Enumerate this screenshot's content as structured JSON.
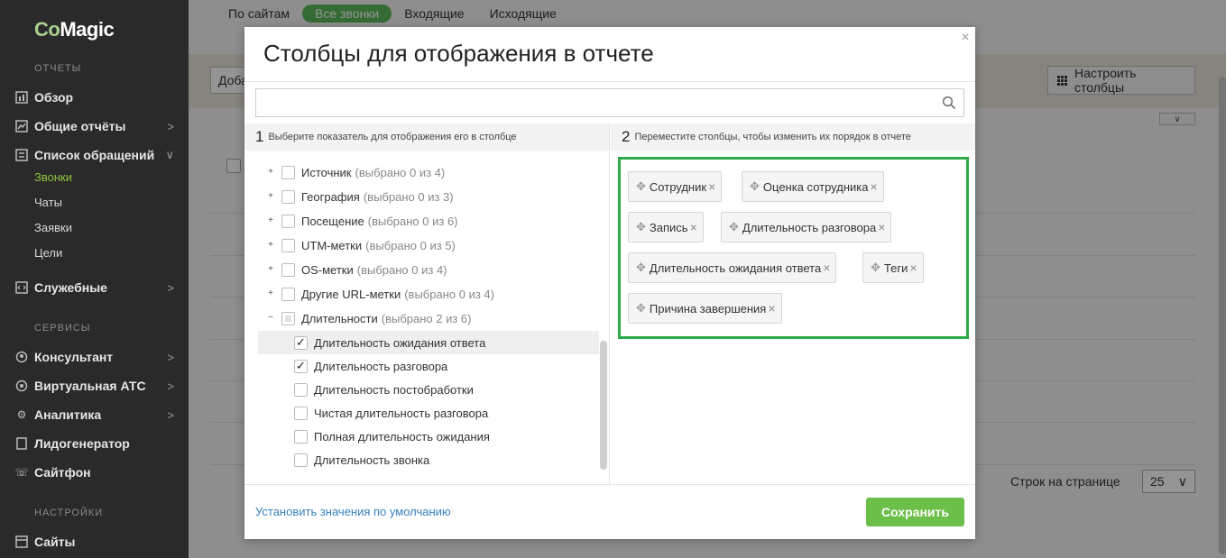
{
  "sidebar": {
    "logo_co": "Co",
    "logo_magic": "Magic",
    "sections": {
      "reports": "ОТЧЕТЫ",
      "services": "СЕРВИСЫ",
      "settings": "НАСТРОЙКИ"
    },
    "items": {
      "overview": "Обзор",
      "general_reports": "Общие отчёты",
      "requests_list": "Список обращений",
      "calls": "Звонки",
      "chats": "Чаты",
      "leads": "Заявки",
      "goals": "Цели",
      "service": "Служебные",
      "consultant": "Консультант",
      "virtual_pbx": "Виртуальная АТС",
      "analytics": "Аналитика",
      "leadgen": "Лидогенератор",
      "sitephone": "Сайтфон",
      "sites": "Сайты"
    },
    "chevron_right": ">",
    "chevron_down": "∨"
  },
  "page": {
    "tabs": [
      "По сайтам",
      "Все звонки",
      "Входящие",
      "Исходящие"
    ],
    "active_tab": "Все звонки",
    "add_button": "Доба",
    "columns_button": "Настроить столбцы",
    "rows_per_page_label": "Строк на странице",
    "rows_per_page_value": "25"
  },
  "modal": {
    "title": "Столбцы для отображения в отчете",
    "close": "×",
    "search": {
      "value": "",
      "placeholder": ""
    },
    "left_header_num": "1",
    "left_header_text": "Выберите показатель для отображения его в столбце",
    "right_header_num": "2",
    "right_header_text": "Переместите столбцы, чтобы изменить их порядок в отчете",
    "tree": [
      {
        "label": "Источник",
        "count": "(выбрано 0 из 4)",
        "expander": "+",
        "state": "unchecked",
        "level": 0
      },
      {
        "label": "География",
        "count": "(выбрано 0 из 3)",
        "expander": "+",
        "state": "unchecked",
        "level": 0
      },
      {
        "label": "Посещение",
        "count": "(выбрано 0 из 6)",
        "expander": "+",
        "state": "unchecked",
        "level": 0
      },
      {
        "label": "UTM-метки",
        "count": "(выбрано 0 из 5)",
        "expander": "+",
        "state": "unchecked",
        "level": 0
      },
      {
        "label": "OS-метки",
        "count": "(выбрано 0 из 4)",
        "expander": "+",
        "state": "unchecked",
        "level": 0
      },
      {
        "label": "Другие URL-метки",
        "count": "(выбрано 0 из 4)",
        "expander": "+",
        "state": "unchecked",
        "level": 0
      },
      {
        "label": "Длительности",
        "count": "(выбрано 2 из 6)",
        "expander": "−",
        "state": "partial",
        "level": 0
      },
      {
        "label": "Длительность ожидания ответа",
        "count": "",
        "expander": "",
        "state": "checked",
        "level": 1,
        "selected": true
      },
      {
        "label": "Длительность разговора",
        "count": "",
        "expander": "",
        "state": "checked",
        "level": 1
      },
      {
        "label": "Длительность постобработки",
        "count": "",
        "expander": "",
        "state": "unchecked",
        "level": 1
      },
      {
        "label": "Чистая длительность разговора",
        "count": "",
        "expander": "",
        "state": "unchecked",
        "level": 1
      },
      {
        "label": "Полная длительность ожидания",
        "count": "",
        "expander": "",
        "state": "unchecked",
        "level": 1
      },
      {
        "label": "Длительность звонка",
        "count": "",
        "expander": "",
        "state": "unchecked",
        "level": 1
      }
    ],
    "check_glyph": "✓",
    "chips": [
      "Сотрудник",
      "Оценка сотрудника",
      "Запись",
      "Длительность разговора",
      "Длительность ожидания ответа",
      "Теги",
      "Причина завершения"
    ],
    "chip_drag_glyph": "✥",
    "chip_remove_glyph": "×",
    "reset_link": "Установить значения по умолчанию",
    "save_button": "Сохранить"
  },
  "colors": {
    "sidebar_bg": "#2a2a2a",
    "accent_green": "#8cc63f",
    "drop_border": "#2eaa4a",
    "save_bg": "#6cc04a",
    "link": "#3a7fbf"
  }
}
